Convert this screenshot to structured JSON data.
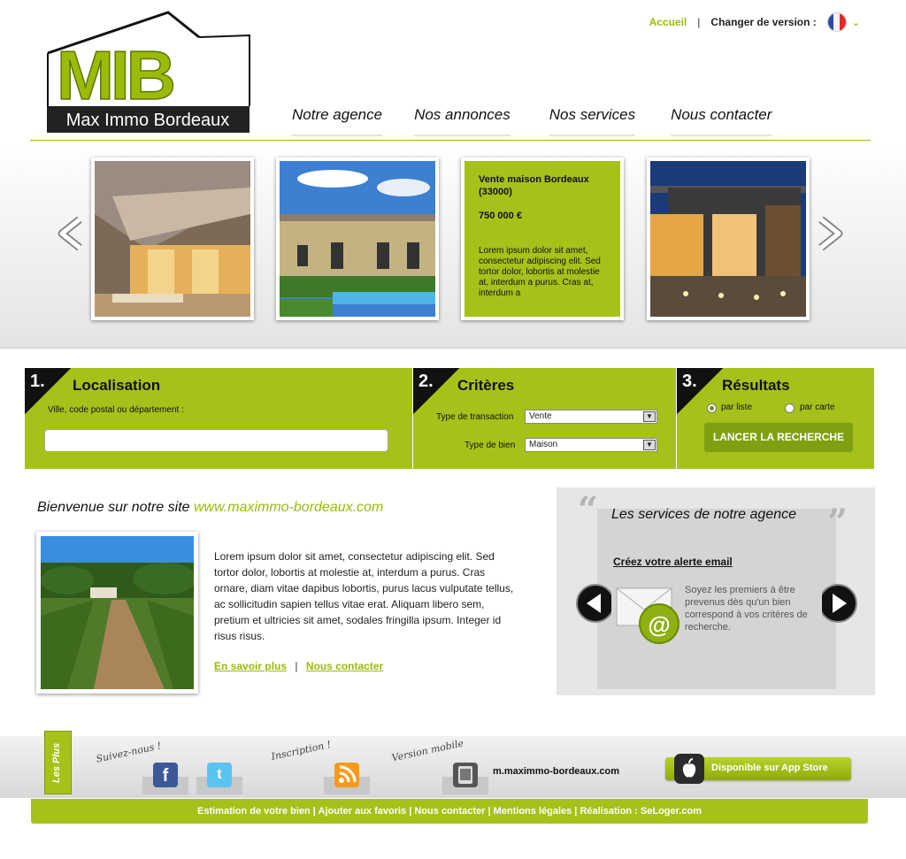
{
  "topbar": {
    "home": "Accueil",
    "separator": "|",
    "version_label": "Changer de version :"
  },
  "logo": {
    "letters": "MIB",
    "name": "Max Immo Bordeaux"
  },
  "nav": {
    "items": [
      "Notre agence",
      "Nos annonces",
      "Nos services",
      "Nous contacter"
    ]
  },
  "feature": {
    "title": "Vente maison Bordeaux (33000)",
    "price": "750 000 €",
    "description": "Lorem ipsum dolor sit amet, consectetur adipiscing elit. Sed tortor dolor, lobortis at molestie at, interdum a purus. Cras at, interdum a"
  },
  "search": {
    "step1": {
      "num": "1.",
      "title": "Localisation",
      "label": "Ville, code postal ou département :",
      "value": ""
    },
    "step2": {
      "num": "2.",
      "title": "Critères",
      "transaction_label": "Type de transaction",
      "transaction_value": "Vente",
      "bien_label": "Type de bien",
      "bien_value": "Maison"
    },
    "step3": {
      "num": "3.",
      "title": "Résultats",
      "opt_list": "par liste",
      "opt_map": "par carte",
      "button": "LANCER LA RECHERCHE"
    }
  },
  "welcome": {
    "title": "Bienvenue sur notre site",
    "url": "www.maximmo-bordeaux.com",
    "text": "Lorem ipsum dolor sit amet, consectetur adipiscing elit. Sed tortor dolor, lobortis at molestie at, interdum a purus. Cras ornare, diam vitae dapibus lobortis, purus lacus vulputate tellus, ac sollicitudin sapien tellus vitae erat. Aliquam libero sem, pretium et ultricies sit amet, sodales fringilla ipsum. Integer id risus risus.",
    "link_more": "En savoir plus",
    "link_sep": "|",
    "link_contact": "Nous contacter"
  },
  "services": {
    "title": "Les services de notre agence",
    "alert_title": "Créez votre alerte email",
    "alert_desc": "Soyez les premiers à être prevenus dès qu'un bien correspond à vos critères de recherche.",
    "quote_open": "“",
    "quote_close": "”"
  },
  "footer": {
    "les_plus": "Les Plus",
    "follow": "Suivez-nous !",
    "inscription": "Inscription !",
    "mobile": "Version mobile",
    "mobile_url": "m.maximmo-bordeaux.com",
    "appstore": "Disponible sur App Store",
    "links": "Estimation de votre bien | Ajouter aux favoris | Nous contacter | Mentions légales | Réalisation : SeLoger.com"
  },
  "colors": {
    "accent": "#a6c11a",
    "accent_text": "#9bbb0a",
    "dark": "#111111"
  },
  "icons": [
    "flag-fr-icon",
    "chevron-down-icon",
    "arrow-left-icon",
    "arrow-right-icon",
    "facebook-icon",
    "twitter-icon",
    "rss-icon",
    "mobile-icon",
    "email-icon",
    "apple-icon"
  ]
}
